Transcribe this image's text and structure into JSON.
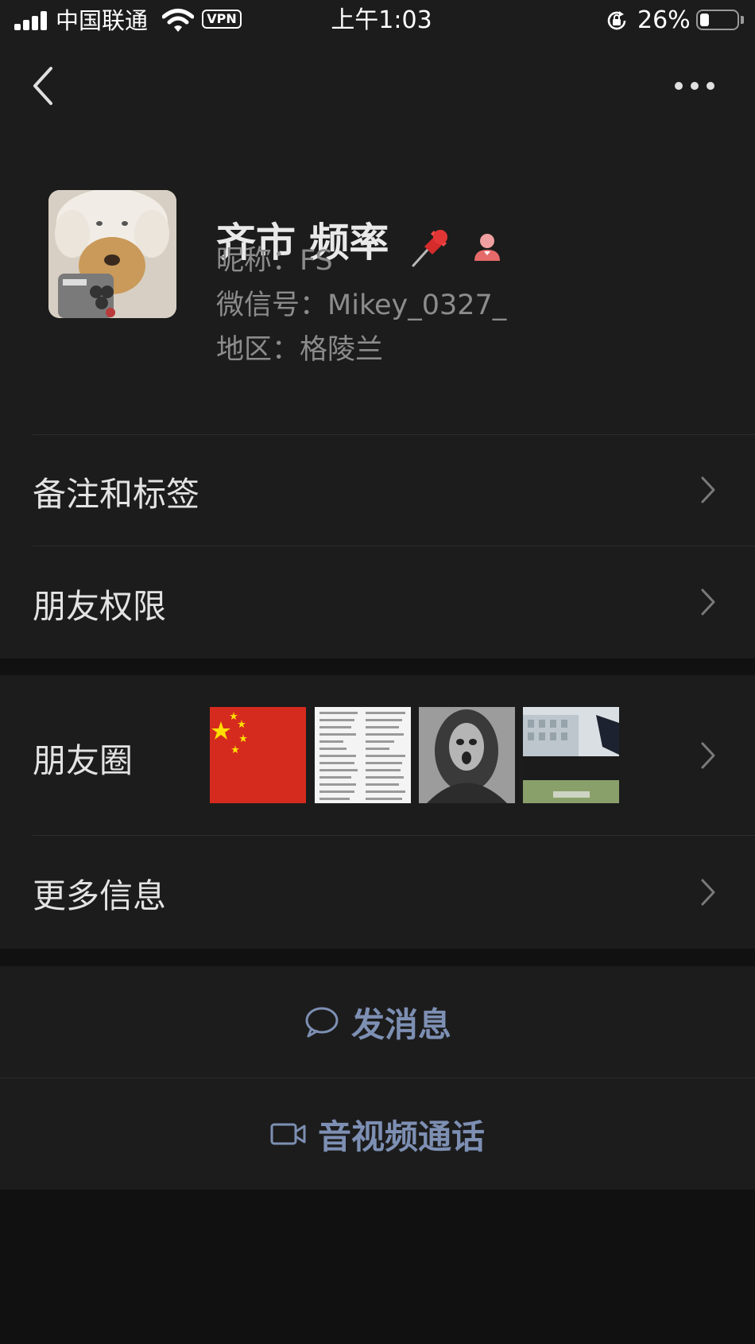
{
  "status_bar": {
    "carrier": "中国联通",
    "vpn": "VPN",
    "time": "上午1:03",
    "battery_percent": "26%",
    "battery_level": 0.26,
    "icons": [
      "signal-icon",
      "wifi-icon",
      "vpn-badge",
      "rotation-lock-icon",
      "battery-icon"
    ]
  },
  "nav": {
    "back_icon": "chevron-left-icon",
    "more_icon": "more-dots-icon"
  },
  "profile": {
    "name": "齐市 频率",
    "name_icons": [
      "pushpin-icon",
      "female-gender-icon"
    ],
    "nickname_label": "昵称：",
    "nickname": "FS",
    "wechat_id_label": "微信号：",
    "wechat_id": "Mikey_0327_",
    "region_label": "地区：",
    "region": "格陵兰"
  },
  "menu": {
    "notes_tags": "备注和标签",
    "friend_permissions": "朋友权限",
    "moments": "朋友圈",
    "more_info": "更多信息"
  },
  "actions": {
    "send_message": "发消息",
    "video_call": "音视频通话"
  },
  "colors": {
    "background": "#111111",
    "panel": "#1c1c1c",
    "action_text": "#7d8fb3",
    "secondary_text": "#8c8c8c"
  }
}
